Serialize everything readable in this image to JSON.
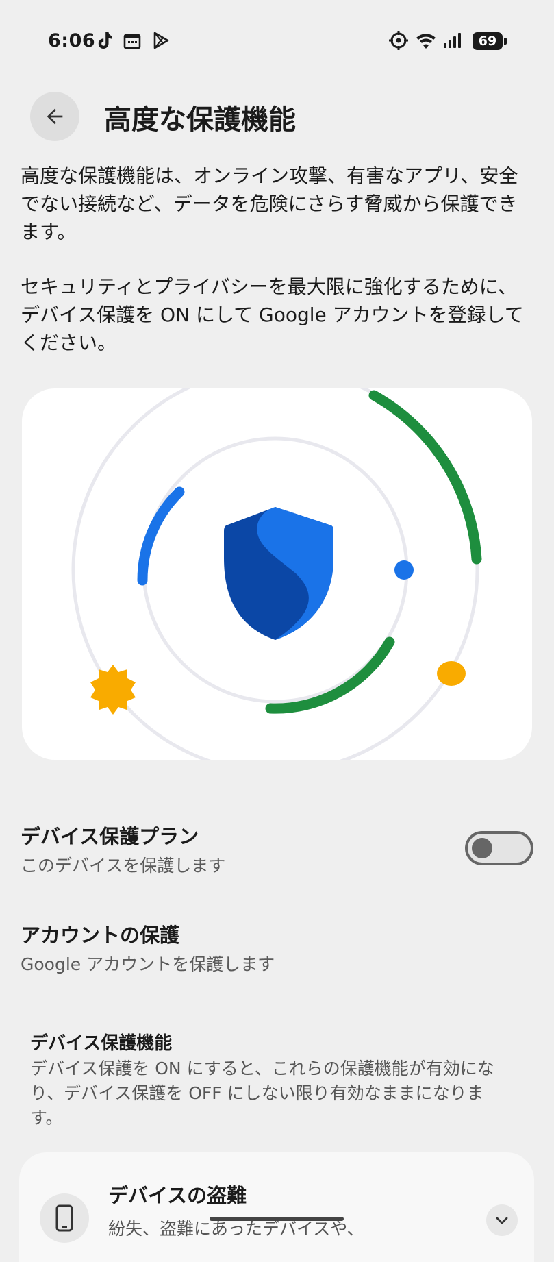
{
  "status_bar": {
    "time": "6:06",
    "battery": "69",
    "left_icons": [
      "tiktok-icon",
      "calendar-icon",
      "play-store-icon"
    ],
    "right_icons": [
      "sync-icon",
      "wifi-icon",
      "signal-icon",
      "battery-icon"
    ]
  },
  "header": {
    "title": "高度な保護機能",
    "back_icon": "arrow-back-icon"
  },
  "intro": {
    "paragraph1": "高度な保護機能は、オンライン攻撃、有害なアプリ、安全でない接続など、データを危険にさらす脅威から保護できます。",
    "paragraph2": "セキュリティとプライバシーを最大限に強化するために、デバイス保護を ON にして Google アカウントを登録してください。"
  },
  "hero": {
    "icon": "shield-icon",
    "colors": {
      "blue": "#1a73e8",
      "dark_blue": "#0b47a6",
      "green": "#1e8e3e",
      "yellow": "#f9ab00",
      "ring": "#e8e8ee"
    }
  },
  "settings": {
    "device_protection": {
      "title": "デバイス保護プラン",
      "subtitle": "このデバイスを保護します",
      "enabled": false
    },
    "account_protection": {
      "title": "アカウントの保護",
      "subtitle": "Google アカウントを保護します"
    }
  },
  "device_features": {
    "title": "デバイス保護機能",
    "description": "デバイス保護を ON にすると、これらの保護機能が有効になり、デバイス保護を OFF にしない限り有効なままになります。",
    "items": [
      {
        "icon": "phone-icon",
        "title": "デバイスの盗難",
        "description": "紛失、盗難にあったデバイスや、",
        "expand_icon": "chevron-down-icon"
      }
    ]
  }
}
